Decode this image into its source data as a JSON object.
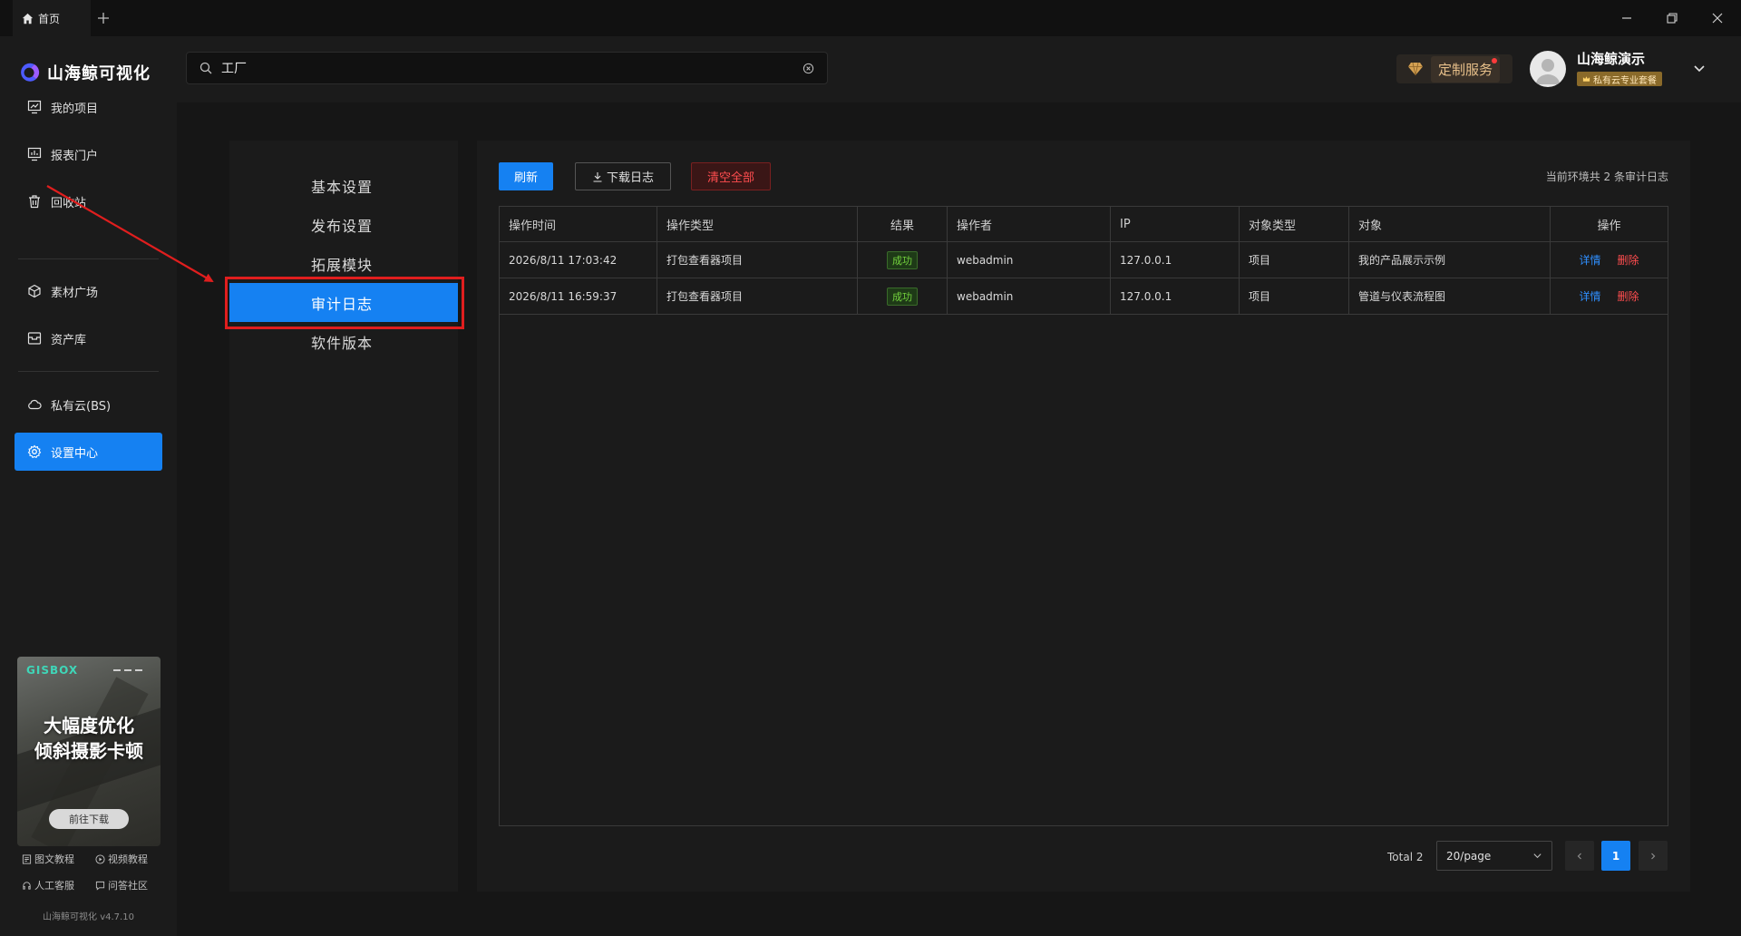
{
  "titlebar": {
    "home_tab": "首页",
    "new_tab_icon": "plus-icon",
    "controls": [
      "minimize-icon",
      "restore-icon",
      "close-icon"
    ]
  },
  "brand": {
    "name": "山海鲸可视化",
    "logo_color": "#4d5bff"
  },
  "sidebar": {
    "items": [
      {
        "label": "我的项目",
        "icon": "project-chart-icon"
      },
      {
        "label": "报表门户",
        "icon": "report-bars-icon"
      },
      {
        "label": "回收站",
        "icon": "trash-icon"
      },
      {
        "label": "素材广场",
        "icon": "cube-icon"
      },
      {
        "label": "资产库",
        "icon": "archive-box-icon"
      },
      {
        "label": "私有云(BS)",
        "icon": "cloud-icon"
      },
      {
        "label": "设置中心",
        "icon": "gear-icon",
        "active": true
      }
    ],
    "promo": {
      "logo": "GISBOX",
      "line1": "大幅度优化",
      "line2": "倾斜摄影卡顿",
      "button": "前往下载"
    },
    "help": [
      "图文教程",
      "视频教程",
      "人工客服",
      "问答社区"
    ],
    "version": "山海鲸可视化 v4.7.10"
  },
  "header": {
    "search_value": "工厂",
    "custom_service": "定制服务",
    "username": "山海鲸演示",
    "plan": "私有云专业套餐"
  },
  "submenu": {
    "items": [
      "基本设置",
      "发布设置",
      "拓展模块",
      "审计日志",
      "软件版本"
    ],
    "active": "审计日志"
  },
  "panel": {
    "refresh": "刷新",
    "download": "下载日志",
    "clear": "清空全部",
    "count_text": "当前环境共 2 条审计日志",
    "columns": [
      "操作时间",
      "操作类型",
      "结果",
      "操作者",
      "IP",
      "对象类型",
      "对象",
      "操作"
    ],
    "rows": [
      {
        "time": "2026/8/11 17:03:42",
        "type": "打包查看器项目",
        "result": "成功",
        "operator": "webadmin",
        "ip": "127.0.0.1",
        "object_type": "项目",
        "object": "我的产品展示示例",
        "detail": "详情",
        "delete": "删除"
      },
      {
        "time": "2026/8/11 16:59:37",
        "type": "打包查看器项目",
        "result": "成功",
        "operator": "webadmin",
        "ip": "127.0.0.1",
        "object_type": "项目",
        "object": "管道与仪表流程图",
        "detail": "详情",
        "delete": "删除"
      }
    ],
    "pagination": {
      "total": "Total 2",
      "page_size": "20/page",
      "current": "1"
    }
  },
  "colors": {
    "accent": "#1581f2",
    "danger": "#ff4d4f",
    "success": "#73d13d",
    "annotation": "#e01e1e"
  }
}
